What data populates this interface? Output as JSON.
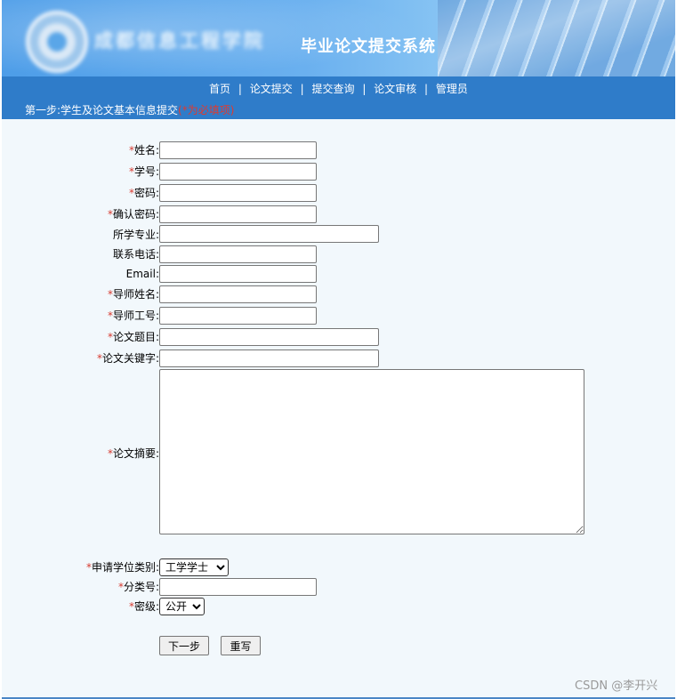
{
  "header": {
    "school_name": "成都信息工程学院",
    "system_title": "毕业论文提交系统"
  },
  "nav": {
    "items": [
      "首页",
      "论文提交",
      "提交查询",
      "论文审核",
      "管理员"
    ],
    "separator": "|"
  },
  "step": {
    "title": "第一步:学生及论文基本信息提交",
    "required_note": "(*为必填项)"
  },
  "form": {
    "required_mark": "*",
    "fields": {
      "name": {
        "label": "姓名:",
        "required": true,
        "value": ""
      },
      "student_id": {
        "label": "学号:",
        "required": true,
        "value": ""
      },
      "password": {
        "label": "密码:",
        "required": true,
        "value": ""
      },
      "confirm_password": {
        "label": "确认密码:",
        "required": true,
        "value": ""
      },
      "major": {
        "label": "所学专业:",
        "required": false,
        "value": ""
      },
      "phone": {
        "label": "联系电话:",
        "required": false,
        "value": ""
      },
      "email": {
        "label": "Email:",
        "required": false,
        "value": ""
      },
      "advisor_name": {
        "label": "导师姓名:",
        "required": true,
        "value": ""
      },
      "advisor_id": {
        "label": "导师工号:",
        "required": true,
        "value": ""
      },
      "thesis_title": {
        "label": "论文题目:",
        "required": true,
        "value": ""
      },
      "keywords": {
        "label": "论文关键字:",
        "required": true,
        "value": ""
      },
      "abstract": {
        "label": "论文摘要:",
        "required": true,
        "value": ""
      },
      "degree_type": {
        "label": "申请学位类别:",
        "required": true,
        "selected": "工学学士"
      },
      "class_no": {
        "label": "分类号:",
        "required": true,
        "value": ""
      },
      "secrecy": {
        "label": "密级:",
        "required": true,
        "selected": "公开"
      }
    },
    "next_button": "下一步",
    "reset_button": "重写"
  },
  "watermark": "CSDN @李开兴"
}
